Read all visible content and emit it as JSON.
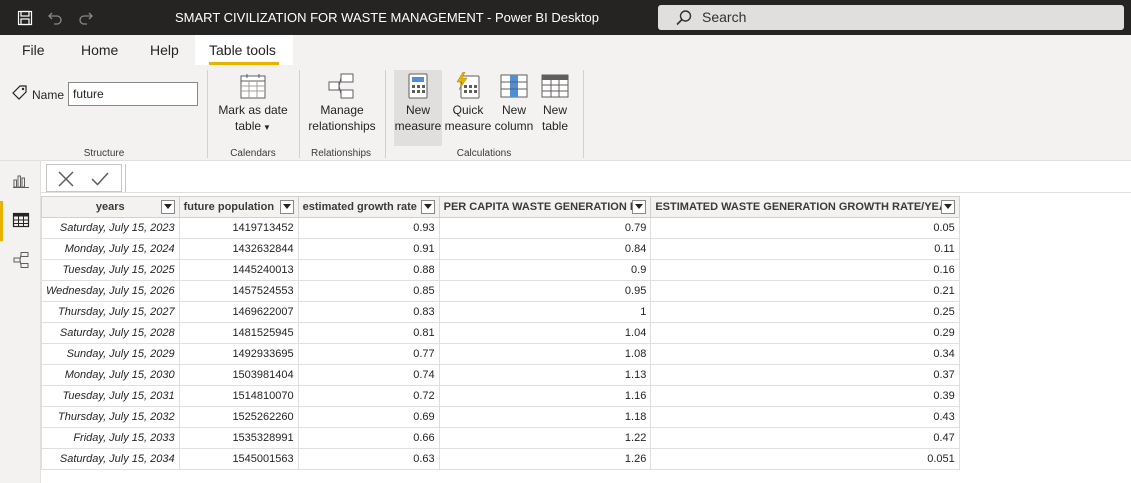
{
  "window": {
    "title": "SMART CIVILIZATION FOR WASTE MANAGEMENT - Power BI Desktop",
    "search_label": "Search"
  },
  "menu": {
    "file": "File",
    "home": "Home",
    "help": "Help",
    "table_tools": "Table tools"
  },
  "ribbon": {
    "name_label": "Name",
    "name_value": "future",
    "mark_date_line1": "Mark as date",
    "mark_date_line2": "table",
    "manage_line1": "Manage",
    "manage_line2": "relationships",
    "new_measure_line1": "New",
    "new_measure_line2": "measure",
    "quick_measure_line1": "Quick",
    "quick_measure_line2": "measure",
    "new_column_line1": "New",
    "new_column_line2": "column",
    "new_table_line1": "New",
    "new_table_line2": "table",
    "group_structure": "Structure",
    "group_calendars": "Calendars",
    "group_relationships": "Relationships",
    "group_calculations": "Calculations"
  },
  "colors": {
    "accent": "#e8b200",
    "titlebar": "#252423",
    "ribbon": "#f3f2f1"
  },
  "table": {
    "headers": [
      "years",
      "future population",
      "estimated growth rate",
      "PER CAPITA WASTE GENERATION KG",
      "ESTIMATED WASTE GENERATION GROWTH RATE/YEAR"
    ],
    "rows": [
      [
        "Saturday, July 15, 2023",
        "1419713452",
        "0.93",
        "0.79",
        "0.05"
      ],
      [
        "Monday, July 15, 2024",
        "1432632844",
        "0.91",
        "0.84",
        "0.11"
      ],
      [
        "Tuesday, July 15, 2025",
        "1445240013",
        "0.88",
        "0.9",
        "0.16"
      ],
      [
        "Wednesday, July 15, 2026",
        "1457524553",
        "0.85",
        "0.95",
        "0.21"
      ],
      [
        "Thursday, July 15, 2027",
        "1469622007",
        "0.83",
        "1",
        "0.25"
      ],
      [
        "Saturday, July 15, 2028",
        "1481525945",
        "0.81",
        "1.04",
        "0.29"
      ],
      [
        "Sunday, July 15, 2029",
        "1492933695",
        "0.77",
        "1.08",
        "0.34"
      ],
      [
        "Monday, July 15, 2030",
        "1503981404",
        "0.74",
        "1.13",
        "0.37"
      ],
      [
        "Tuesday, July 15, 2031",
        "1514810070",
        "0.72",
        "1.16",
        "0.39"
      ],
      [
        "Thursday, July 15, 2032",
        "1525262260",
        "0.69",
        "1.18",
        "0.43"
      ],
      [
        "Friday, July 15, 2033",
        "1535328991",
        "0.66",
        "1.22",
        "0.47"
      ],
      [
        "Saturday, July 15, 2034",
        "1545001563",
        "0.63",
        "1.26",
        "0.051"
      ]
    ]
  }
}
